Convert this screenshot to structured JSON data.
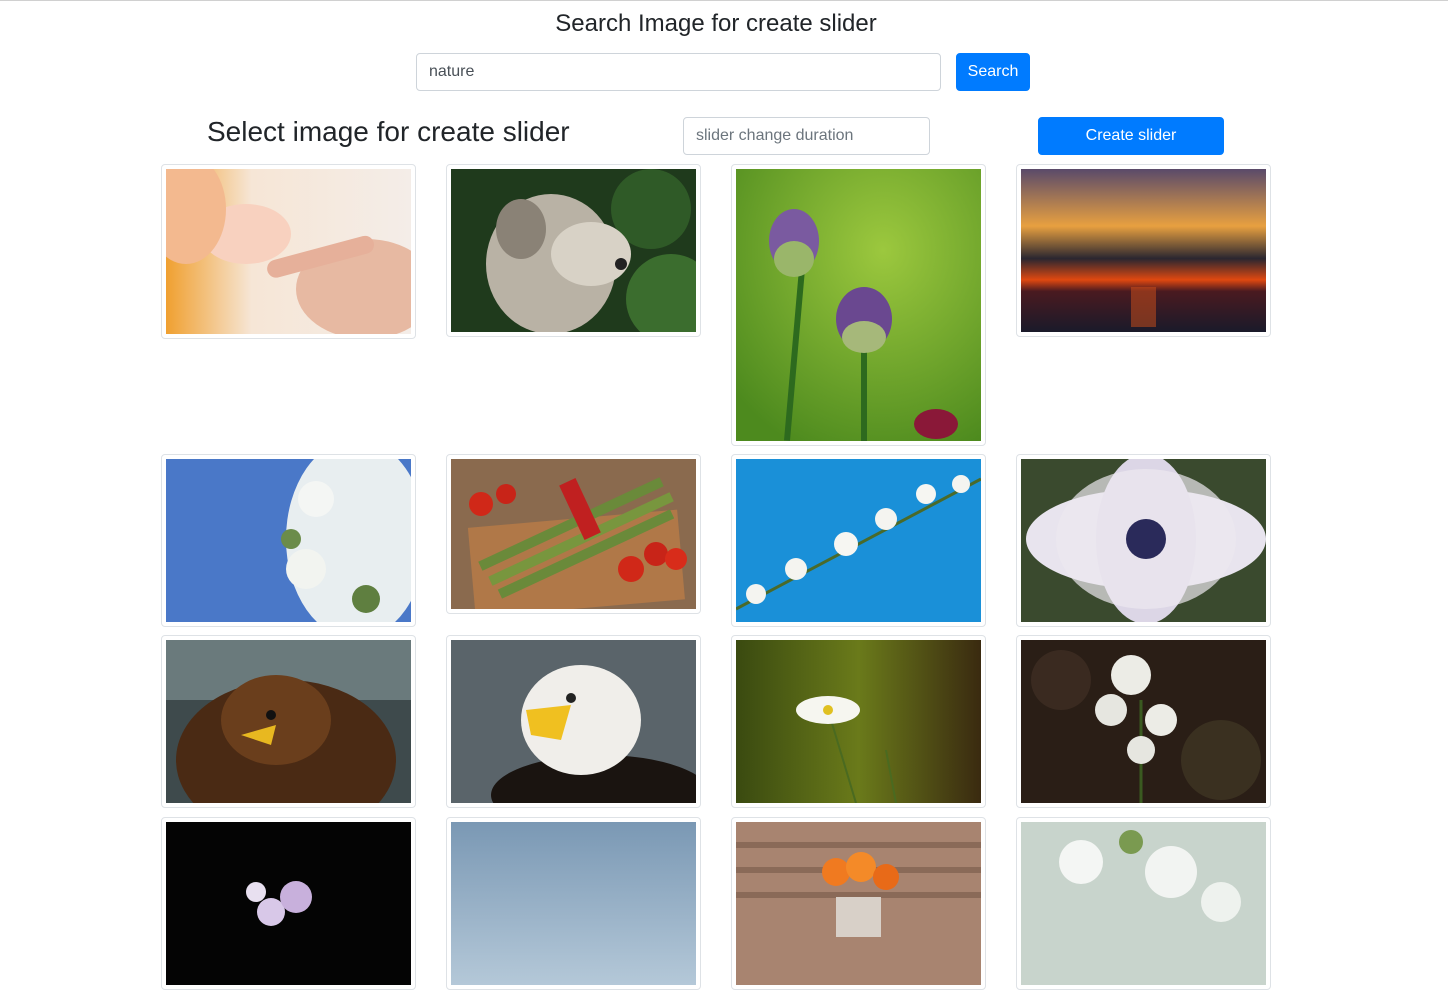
{
  "header": {
    "title": "Search Image for create slider"
  },
  "search": {
    "value": "nature",
    "button_label": "Search"
  },
  "gallery": {
    "title": "Select image for create slider",
    "duration_placeholder": "slider change duration",
    "create_button_label": "Create slider"
  },
  "images": [
    "baby-hand-holding-finger-image",
    "dog-portrait-image",
    "allium-flowers-image",
    "sunset-over-sea-image",
    "white-blossom-branch-blue-sky-image",
    "asparagus-and-tomatoes-image",
    "cherry-blossom-branch-image",
    "white-daisy-flower-image",
    "brown-eagle-image",
    "bald-eagle-image",
    "white-wildflower-image",
    "white-flower-cluster-image",
    "flowers-on-black-image",
    "sky-image",
    "orange-tulips-in-vase-image",
    "white-blossoms-image"
  ],
  "colors": {
    "primary": "#007bff"
  }
}
